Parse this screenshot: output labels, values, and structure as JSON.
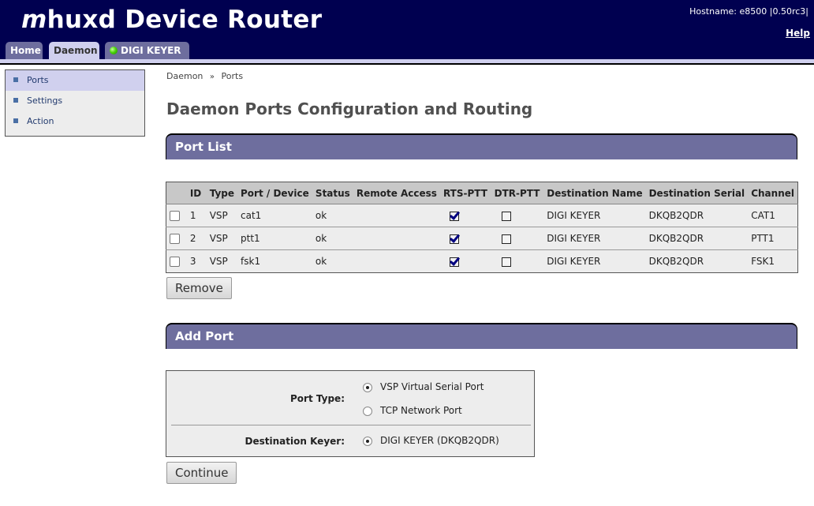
{
  "header": {
    "title_prefix": "m",
    "title_rest": "huxd Device Router",
    "hostname": "Hostname: e8500 |0.50rc3|",
    "help_label": "Help"
  },
  "tabs": [
    {
      "label": "Home",
      "active": false
    },
    {
      "label": "Daemon",
      "active": true
    },
    {
      "label": "DIGI KEYER",
      "active": false,
      "status_led": "green"
    }
  ],
  "sidebar": {
    "items": [
      {
        "label": "Ports",
        "active": true
      },
      {
        "label": "Settings",
        "active": false
      },
      {
        "label": "Action",
        "active": false
      }
    ]
  },
  "breadcrumb": {
    "items": [
      "Daemon",
      "Ports"
    ],
    "separator": "»"
  },
  "page_title": "Daemon Ports Configuration and Routing",
  "port_list": {
    "section_title": "Port List",
    "columns": [
      "",
      "ID",
      "Type",
      "Port / Device",
      "Status",
      "Remote Access",
      "RTS-PTT",
      "DTR-PTT",
      "Destination Name",
      "Destination Serial",
      "Channel"
    ],
    "rows": [
      {
        "selected": false,
        "id": "1",
        "type": "VSP",
        "device": "cat1",
        "status": "ok",
        "remote_access": "",
        "rts_ptt": true,
        "dtr_ptt": false,
        "dest_name": "DIGI KEYER",
        "dest_serial": "DKQB2QDR",
        "channel": "CAT1"
      },
      {
        "selected": false,
        "id": "2",
        "type": "VSP",
        "device": "ptt1",
        "status": "ok",
        "remote_access": "",
        "rts_ptt": true,
        "dtr_ptt": false,
        "dest_name": "DIGI KEYER",
        "dest_serial": "DKQB2QDR",
        "channel": "PTT1"
      },
      {
        "selected": false,
        "id": "3",
        "type": "VSP",
        "device": "fsk1",
        "status": "ok",
        "remote_access": "",
        "rts_ptt": true,
        "dtr_ptt": false,
        "dest_name": "DIGI KEYER",
        "dest_serial": "DKQB2QDR",
        "channel": "FSK1"
      }
    ],
    "remove_label": "Remove"
  },
  "add_port": {
    "section_title": "Add Port",
    "port_type_label": "Port Type:",
    "port_type_options": [
      {
        "label": "VSP Virtual Serial Port",
        "selected": true
      },
      {
        "label": "TCP Network Port",
        "selected": false
      }
    ],
    "dest_keyer_label": "Destination Keyer:",
    "dest_keyer_options": [
      {
        "label": "DIGI KEYER (DKQB2QDR)",
        "selected": true
      }
    ],
    "continue_label": "Continue"
  },
  "colors": {
    "header_bg": "#000050",
    "section_bar": "#6e6e9e",
    "active_tab": "#d0d0ee",
    "panel_bg": "#ededed",
    "table_header_bg": "#c8c8c8",
    "check_color": "#000080"
  }
}
